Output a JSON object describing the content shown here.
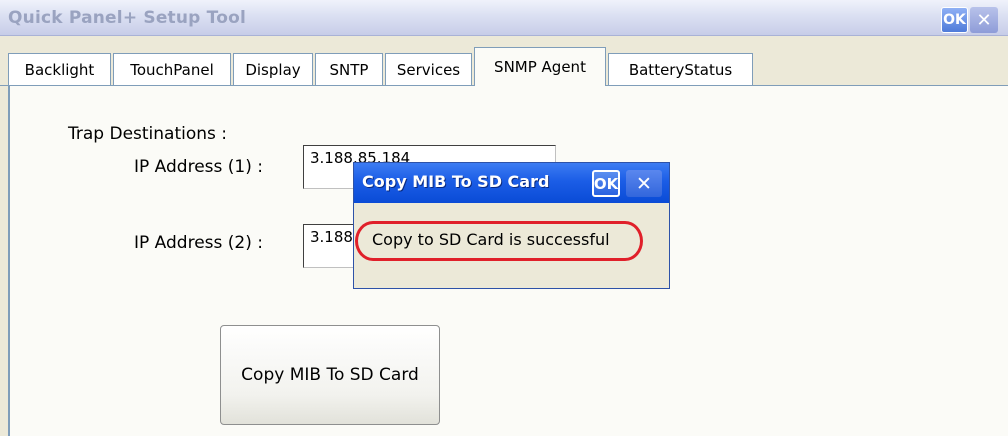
{
  "window": {
    "title": "Quick Panel+ Setup Tool",
    "ok_label": "OK",
    "close_glyph": "✕"
  },
  "tabs": [
    {
      "label": "Backlight"
    },
    {
      "label": "TouchPanel"
    },
    {
      "label": "Display"
    },
    {
      "label": "SNTP"
    },
    {
      "label": "Services"
    },
    {
      "label": "SNMP Agent",
      "active": true
    },
    {
      "label": "BatteryStatus"
    }
  ],
  "snmp": {
    "trap_heading": "Trap Destinations :",
    "ip1_label": "IP Address (1) :",
    "ip1_value": "3.188.85.184",
    "ip2_label": "IP Address (2) :",
    "ip2_value": "3.188",
    "copy_button_label": "Copy MIB To SD Card"
  },
  "dialog": {
    "title": "Copy MIB To SD Card",
    "ok_label": "OK",
    "close_glyph": "✕",
    "message": "Copy to SD Card is successful"
  },
  "colors": {
    "window_bg": "#ece9d8",
    "panel_bg": "#fbfbf7",
    "dialog_title_blue": "#1b5de6",
    "highlight_red": "#e0202a"
  }
}
